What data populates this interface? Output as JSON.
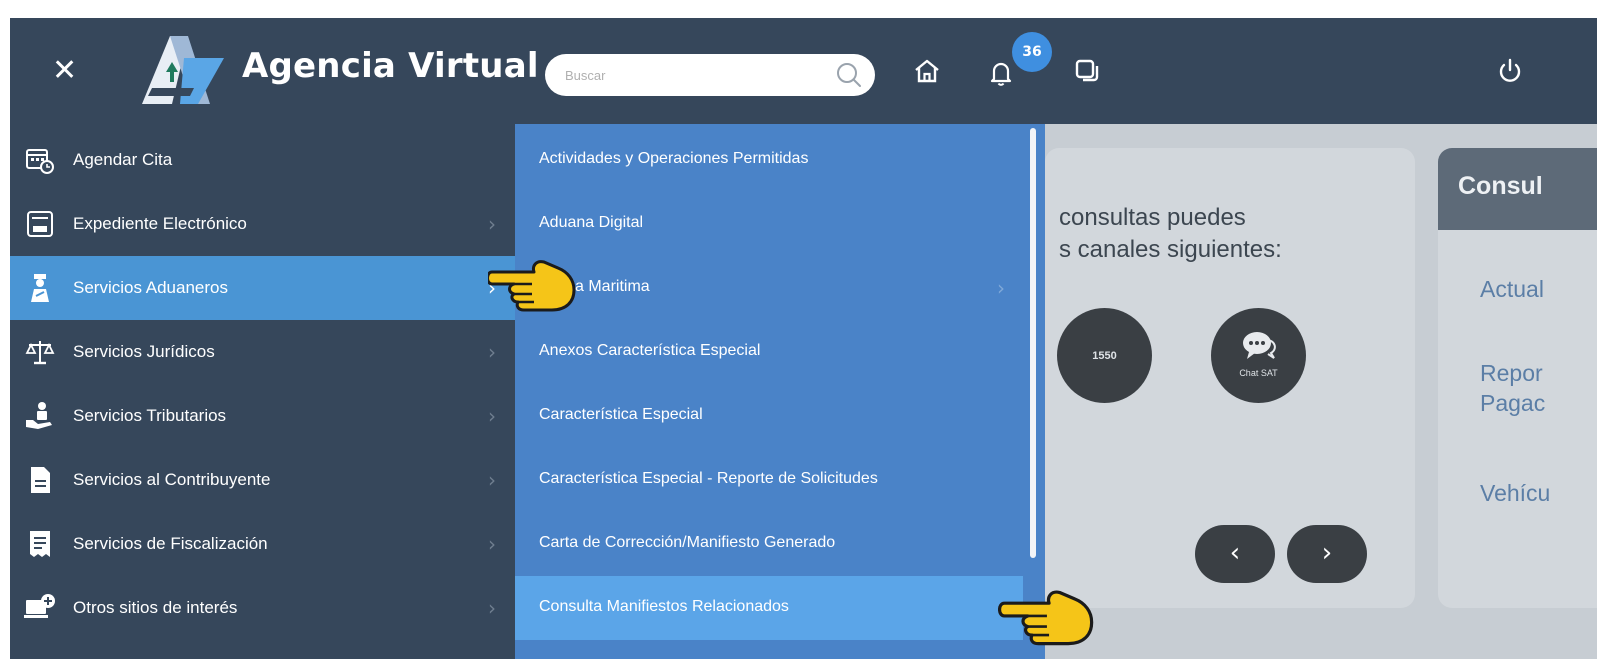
{
  "header": {
    "app_title": "Agencia Virtual",
    "search_placeholder": "Buscar",
    "notification_count": "36"
  },
  "sidebar": {
    "items": [
      {
        "label": "Agendar Cita"
      },
      {
        "label": "Expediente Electrónico"
      },
      {
        "label": "Servicios Aduaneros"
      },
      {
        "label": "Servicios Jurídicos"
      },
      {
        "label": "Servicios Tributarios"
      },
      {
        "label": "Servicios al Contribuyente"
      },
      {
        "label": "Servicios de Fiscalización"
      },
      {
        "label": "Otros sitios de interés"
      }
    ]
  },
  "submenu": {
    "items": [
      {
        "label": "Actividades y Operaciones Permitidas"
      },
      {
        "label": "Aduana Digital"
      },
      {
        "label": "a Maritima"
      },
      {
        "label": "Anexos Característica Especial"
      },
      {
        "label": "Característica Especial"
      },
      {
        "label": "Característica Especial - Reporte de Solicitudes"
      },
      {
        "label": "Carta de Corrección/Manifiesto Generado"
      },
      {
        "label": "Consulta Manifiestos Relacionados"
      }
    ]
  },
  "content": {
    "card1_line1": "consultas puedes",
    "card1_line2": "s canales siguientes:",
    "phone_label": "1550",
    "chat_label": "Chat SAT",
    "card2_title": "Consul",
    "card2_links": [
      "Actual",
      "Repor",
      "Pagac",
      "Vehícu"
    ]
  },
  "colors": {
    "header_bg": "#36475b",
    "submenu_bg": "#4a83c8",
    "active_bg": "#4a95d4",
    "badge_bg": "#3f8fe0"
  }
}
